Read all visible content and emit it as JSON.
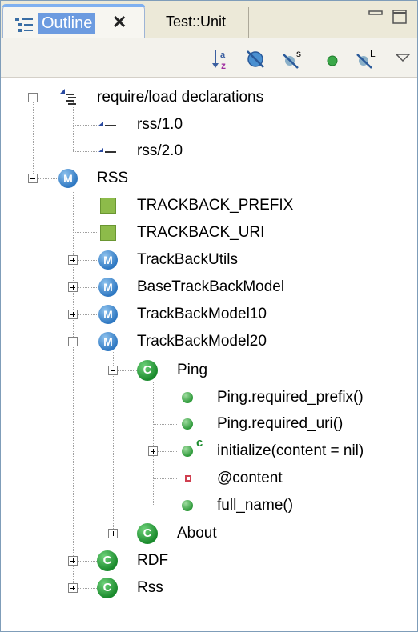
{
  "tabs": {
    "active_label": "Outline",
    "close_glyph": "✕",
    "inactive_label": "Test::Unit"
  },
  "toolbar": {
    "buttons": [
      "sort-alpha-icon",
      "hide-fields-icon",
      "hide-static-icon",
      "hide-non-public-icon",
      "hide-local-types-icon",
      "view-menu-icon"
    ]
  },
  "tree": {
    "require_group": "require/load declarations",
    "require_items": [
      "rss/1.0",
      "rss/2.0"
    ],
    "module_rss": "RSS",
    "constants": [
      "TRACKBACK_PREFIX",
      "TRACKBACK_URI"
    ],
    "modules": [
      "TrackBackUtils",
      "BaseTrackBackModel",
      "TrackBackModel10",
      "TrackBackModel20"
    ],
    "class_ping": "Ping",
    "ping_members": [
      "Ping.required_prefix()",
      "Ping.required_uri()",
      "initialize(content = nil)",
      "@content",
      "full_name()"
    ],
    "constructor_badge": "c",
    "class_about": "About",
    "top_classes": [
      "RDF",
      "Rss"
    ]
  },
  "colors": {
    "tab_highlight": "#6c9be0",
    "module_icon": "#2f78c2",
    "class_icon": "#1a8a2c",
    "constant_icon": "#8dbb4a",
    "field_icon": "#d04050"
  }
}
